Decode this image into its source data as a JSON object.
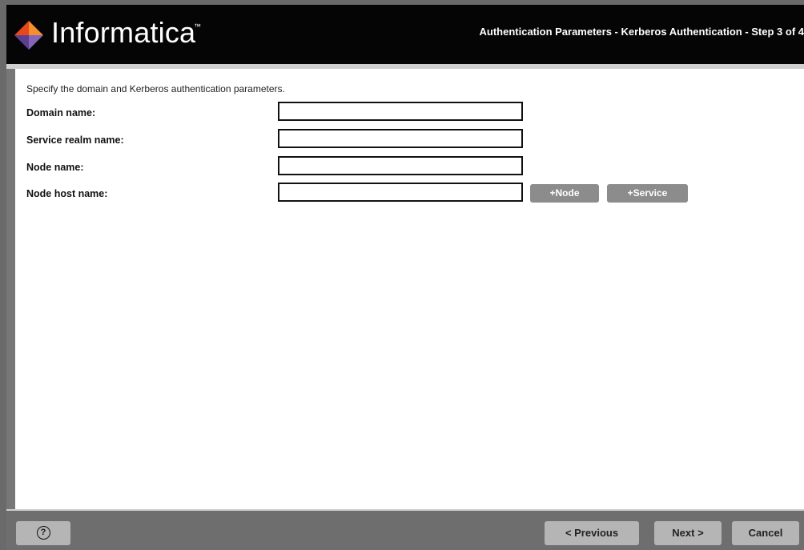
{
  "header": {
    "brand": "Informatica",
    "trademark": "™",
    "step_title": "Authentication Parameters - Kerberos Authentication - Step 3 of 4"
  },
  "form": {
    "intro": "Specify the domain and Kerberos authentication parameters.",
    "fields": [
      {
        "label": "Domain name:",
        "value": ""
      },
      {
        "label": "Service realm name:",
        "value": ""
      },
      {
        "label": "Node name:",
        "value": ""
      },
      {
        "label": "Node host name:",
        "value": ""
      }
    ],
    "add_node_label": "+Node",
    "add_service_label": "+Service"
  },
  "footer": {
    "help_icon": "question-circle-icon",
    "help_glyph": "?",
    "previous_label": "< Previous",
    "next_label": "Next >",
    "cancel_label": "Cancel"
  },
  "colors": {
    "header_background": "#050505",
    "logo_orange": "#f26b21",
    "logo_purple": "#6b4ea0",
    "footer_background": "#6e6e6e",
    "button_background": "#b5b5b5",
    "side_button_background": "#8c8c8c"
  }
}
